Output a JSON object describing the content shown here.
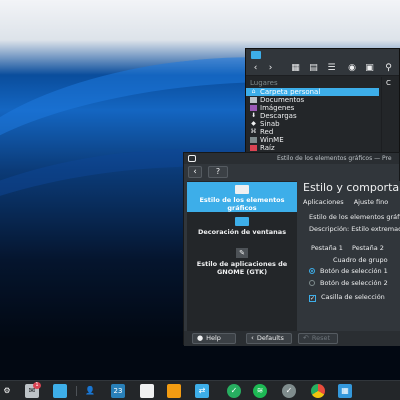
{
  "dolphin": {
    "places_header": "Lugares",
    "places": [
      {
        "label": "Carpeta personal",
        "icon": "home-icon",
        "active": true
      },
      {
        "label": "Documentos",
        "icon": "documents-icon"
      },
      {
        "label": "Imágenes",
        "icon": "images-icon"
      },
      {
        "label": "Descargas",
        "icon": "downloads-icon"
      },
      {
        "label": "Sinab",
        "icon": "network-drive-icon"
      },
      {
        "label": "Red",
        "icon": "network-icon"
      },
      {
        "label": "WinME",
        "icon": "drive-icon"
      },
      {
        "label": "Raíz",
        "icon": "root-folder-icon"
      }
    ],
    "column_label": "C"
  },
  "settings": {
    "title": "Estilo de los elementos gráficos — Pre",
    "help_label": "?",
    "categories": [
      {
        "label": "Estilo de los elementos gráficos",
        "icon": "widget-style-icon",
        "active": true
      },
      {
        "label": "Decoración de ventanas",
        "icon": "window-decoration-icon"
      },
      {
        "label": "Estilo de aplicaciones de GNOME (GTK)",
        "icon": "gtk-icon"
      }
    ],
    "page_title": "Estilo y comportamiento",
    "tabs": [
      "Aplicaciones",
      "Ajuste fino"
    ],
    "widget_style_label": "Estilo de los elementos gráficos:",
    "description_label": "Descripción: Estilo extremadamente",
    "preview_tabs": [
      "Pestaña 1",
      "Pestaña 2"
    ],
    "group_label": "Cuadro de grupo",
    "radio1": "Botón de selección 1",
    "radio2": "Botón de selección 2",
    "checkbox": "Casilla de selección",
    "buttons": {
      "help": "Help",
      "defaults": "Defaults",
      "reset": "Reset"
    }
  },
  "taskbar": {
    "items": [
      {
        "name": "app-launcher-icon",
        "color": "#eff0f1"
      },
      {
        "name": "mail-icon",
        "color": "#bdc3c7",
        "badge": "1"
      },
      {
        "name": "file-manager-icon",
        "color": "#3daee9"
      },
      {
        "name": "contacts-icon",
        "color": "#eff0f1"
      },
      {
        "name": "calendar-icon",
        "color": "#2980b9",
        "text": "23"
      },
      {
        "name": "text-editor-icon",
        "color": "#eff0f1"
      },
      {
        "name": "tasks-icon",
        "color": "#eff0f1"
      },
      {
        "name": "remote-desktop-icon",
        "color": "#3daee9"
      },
      {
        "name": "security-icon",
        "color": "#27ae60"
      },
      {
        "name": "spotify-icon",
        "color": "#1db954"
      },
      {
        "name": "system-settings-icon",
        "color": "#7f8c8d"
      },
      {
        "name": "chrome-icon",
        "color": "#e74c3c"
      },
      {
        "name": "calculator-icon",
        "color": "#3498db"
      }
    ]
  }
}
